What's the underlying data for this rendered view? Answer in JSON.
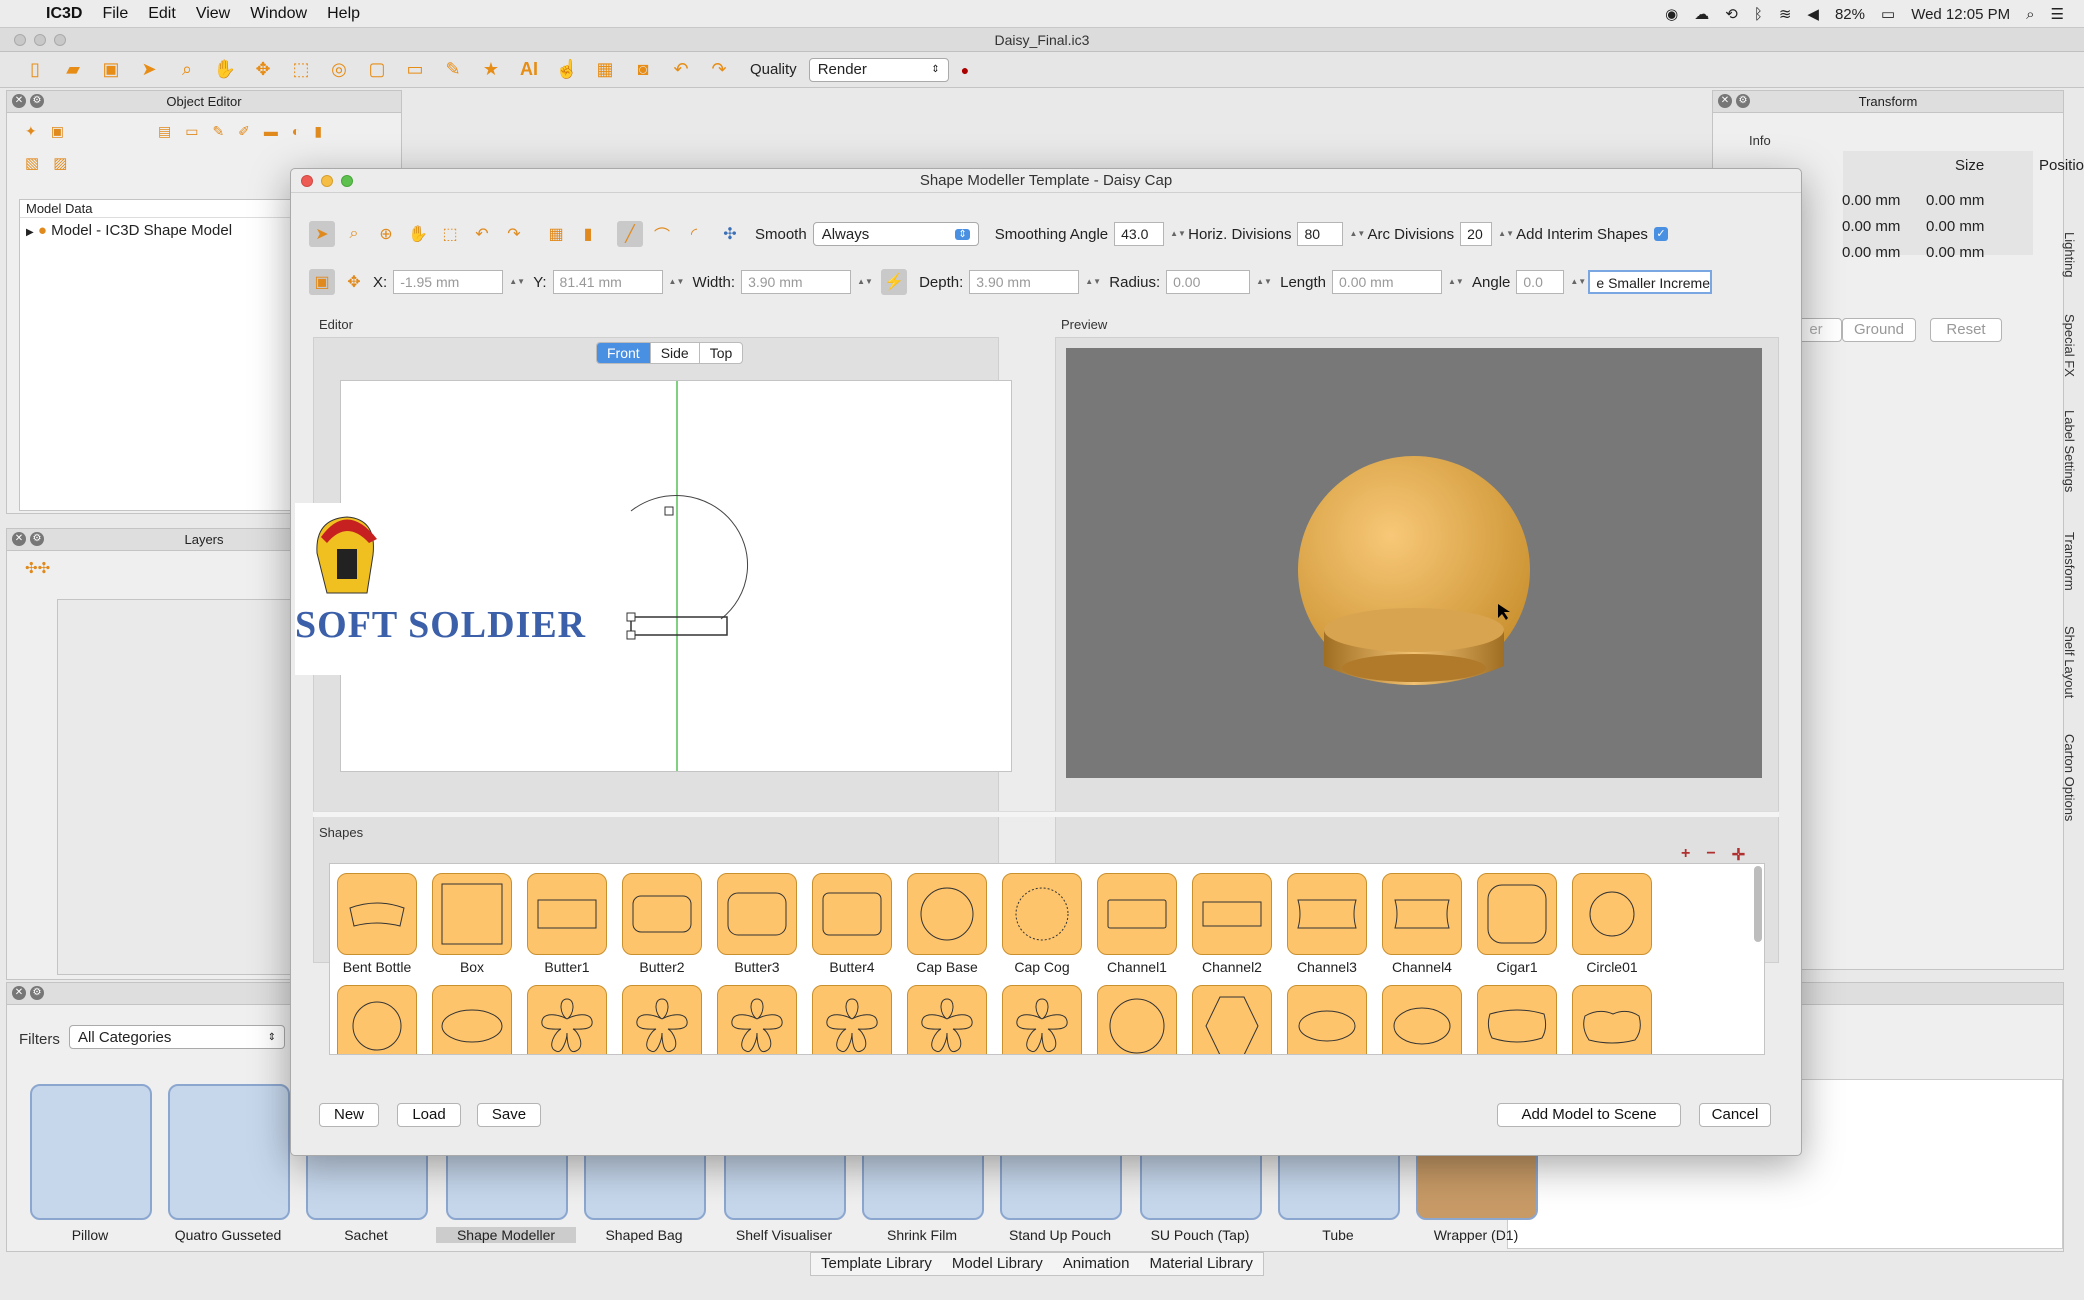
{
  "menubar": {
    "app": "IC3D",
    "menus": [
      "File",
      "Edit",
      "View",
      "Window",
      "Help"
    ],
    "battery": "82%",
    "clock": "Wed 12:05 PM"
  },
  "window": {
    "title": "Daisy_Final.ic3"
  },
  "toolbar": {
    "quality_label": "Quality",
    "quality_value": "Render"
  },
  "object_editor": {
    "title": "Object Editor",
    "model_data_label": "Model Data",
    "tree_item": "Model - IC3D Shape Model"
  },
  "layers": {
    "title": "Layers"
  },
  "transform": {
    "title": "Transform",
    "info_label": "Info",
    "size_header": "Size",
    "position_header": "Position",
    "rows": [
      [
        "0.00 mm",
        "0.00 mm"
      ],
      [
        "0.00 mm",
        "0.00 mm"
      ],
      [
        "0.00 mm",
        "0.00 mm"
      ]
    ],
    "btn_partial": "er",
    "ground": "Ground",
    "reset": "Reset"
  },
  "side_tabs": [
    "Lighting",
    "Special FX",
    "Label Settings",
    "Transform",
    "Shelf Layout",
    "Carton Options"
  ],
  "filters": {
    "label": "Filters",
    "value": "All Categories"
  },
  "library": {
    "tiles": [
      "Pillow",
      "Quatro Gusseted",
      "Sachet",
      "Shape Modeller",
      "Shaped Bag",
      "Shelf Visualiser",
      "Shrink Film",
      "Stand Up Pouch",
      "SU Pouch (Tap)",
      "Tube",
      "Wrapper (D1)"
    ],
    "tabs": [
      "Template Library",
      "Model Library",
      "Animation",
      "Material Library"
    ]
  },
  "dialog": {
    "title": "Shape Modeller Template - Daisy Cap",
    "smooth_label": "Smooth",
    "smooth_value": "Always",
    "smoothing_angle_label": "Smoothing Angle",
    "smoothing_angle": "43.0",
    "horiz_div_label": "Horiz. Divisions",
    "horiz_div": "80",
    "arc_div_label": "Arc Divisions",
    "arc_div": "20",
    "interim_label": "Add Interim Shapes",
    "x_label": "X:",
    "x": "-1.95 mm",
    "y_label": "Y:",
    "y": "81.41 mm",
    "width_label": "Width:",
    "width": "3.90 mm",
    "depth_label": "Depth:",
    "depth": "3.90 mm",
    "radius_label": "Radius:",
    "radius": "0.00",
    "length_label": "Length",
    "length": "0.00 mm",
    "angle_label": "Angle",
    "angle": "0.0",
    "increment": "e Smaller Incremer",
    "editor_label": "Editor",
    "preview_label": "Preview",
    "view_tabs": [
      "Front",
      "Side",
      "Top"
    ],
    "shapes_label": "Shapes",
    "shape_names": [
      "Bent Bottle",
      "Box",
      "Butter1",
      "Butter2",
      "Butter3",
      "Butter4",
      "Cap Base",
      "Cap Cog",
      "Channel1",
      "Channel2",
      "Channel3",
      "Channel4",
      "Cigar1",
      "Circle01"
    ],
    "new": "New",
    "load": "Load",
    "save": "Save",
    "add_to_scene": "Add Model to Scene",
    "cancel": "Cancel"
  },
  "watermark": {
    "text": "SOFT SOLDIER"
  },
  "colors": {
    "accent": "#fdc46c",
    "selected_tab": "#4a90e2",
    "preview_bg": "#787878"
  }
}
